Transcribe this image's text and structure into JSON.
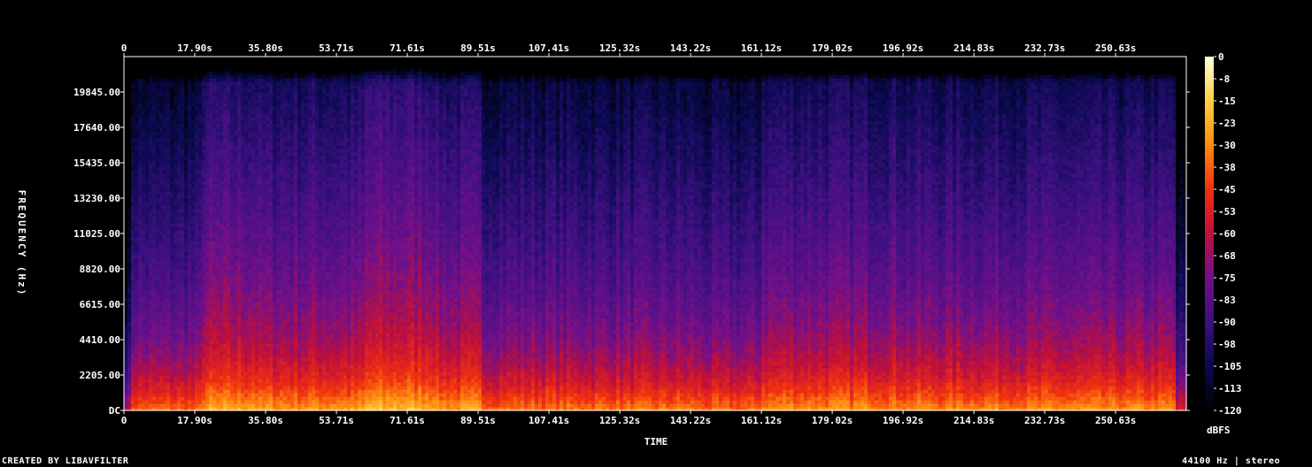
{
  "footer": {
    "credit": "CREATED BY LIBAVFILTER",
    "format": "44100 Hz | stereo"
  },
  "chart_data": {
    "type": "heatmap",
    "title": "",
    "xlabel": "TIME",
    "ylabel": "FREQUENCY (Hz)",
    "x_ticks": [
      "0",
      "17.90s",
      "35.80s",
      "53.71s",
      "71.61s",
      "89.51s",
      "107.41s",
      "125.32s",
      "143.22s",
      "161.12s",
      "179.02s",
      "196.92s",
      "214.83s",
      "232.73s",
      "250.63s"
    ],
    "x_tick_values": [
      0,
      17.9,
      35.8,
      53.71,
      71.61,
      89.51,
      107.41,
      125.32,
      143.22,
      161.12,
      179.02,
      196.92,
      214.83,
      232.73,
      250.63
    ],
    "xlim": [
      0,
      268.5
    ],
    "y_ticks": [
      "DC",
      "2205.00",
      "4410.00",
      "6615.00",
      "8820.00",
      "11025.00",
      "13230.00",
      "15435.00",
      "17640.00",
      "19845.00"
    ],
    "y_tick_values": [
      0,
      2205,
      4410,
      6615,
      8820,
      11025,
      13230,
      15435,
      17640,
      19845
    ],
    "ylim": [
      0,
      22050
    ],
    "colorbar": {
      "label": "dBFS",
      "ticks": [
        "0",
        "-8",
        "-15",
        "-23",
        "-30",
        "-38",
        "-45",
        "-53",
        "-60",
        "-68",
        "-75",
        "-83",
        "-90",
        "-98",
        "-105",
        "-113",
        "-120"
      ],
      "range": [
        -120,
        0
      ],
      "colors": [
        "#000000",
        "#0a0a50",
        "#3c1080",
        "#70108a",
        "#c0103a",
        "#f03010",
        "#ff8a10",
        "#ffd040",
        "#ffffe0"
      ]
    },
    "sections": [
      {
        "start": 0,
        "end": 20,
        "level": -73
      },
      {
        "start": 20,
        "end": 34,
        "level": -60
      },
      {
        "start": 34,
        "end": 61,
        "level": -63
      },
      {
        "start": 61,
        "end": 79,
        "level": -56
      },
      {
        "start": 79,
        "end": 90,
        "level": -62
      },
      {
        "start": 90,
        "end": 145,
        "level": -70
      },
      {
        "start": 145,
        "end": 161,
        "level": -72
      },
      {
        "start": 161,
        "end": 197,
        "level": -64
      },
      {
        "start": 197,
        "end": 268.5,
        "level": -66
      }
    ],
    "grid": false,
    "legend": "colorbar-right"
  }
}
